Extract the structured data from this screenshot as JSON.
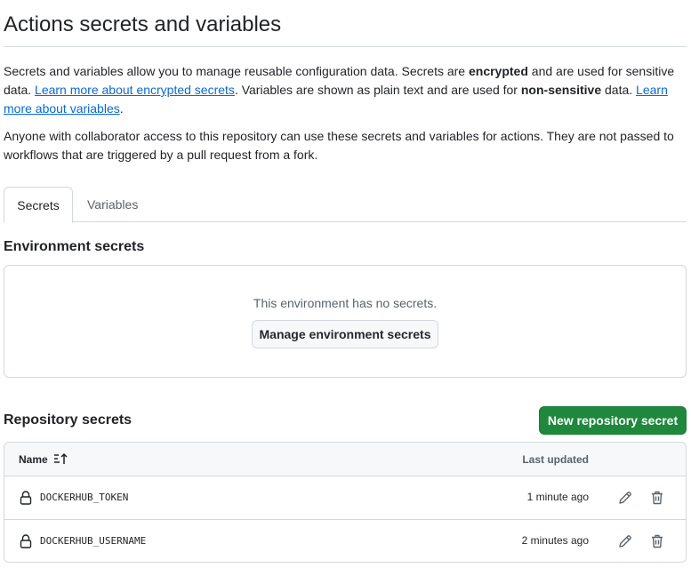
{
  "page": {
    "title": "Actions secrets and variables"
  },
  "intro": {
    "t1": "Secrets and variables allow you to manage reusable configuration data. Secrets are ",
    "b1": "encrypted",
    "t2": " and are used for sensitive data. ",
    "link1": "Learn more about encrypted secrets",
    "t3": ". Variables are shown as plain text and are used for ",
    "b2": "non-sensitive",
    "t4": " data. ",
    "link2": "Learn more about variables",
    "t5": "."
  },
  "note": "Anyone with collaborator access to this repository can use these secrets and variables for actions. They are not passed to workflows that are triggered by a pull request from a fork.",
  "tabs": [
    {
      "label": "Secrets",
      "active": true
    },
    {
      "label": "Variables",
      "active": false
    }
  ],
  "environment": {
    "heading": "Environment secrets",
    "empty_text": "This environment has no secrets.",
    "manage_button": "Manage environment secrets"
  },
  "repository": {
    "heading": "Repository secrets",
    "new_button": "New repository secret",
    "columns": {
      "name": "Name",
      "last_updated": "Last updated"
    },
    "rows": [
      {
        "name": "DOCKERHUB_TOKEN",
        "updated": "1 minute ago"
      },
      {
        "name": "DOCKERHUB_USERNAME",
        "updated": "2 minutes ago"
      }
    ]
  },
  "colors": {
    "link": "#0969da",
    "primary_button": "#1f883d",
    "border": "#d1d9e0",
    "muted": "#59636e"
  },
  "icons": {
    "sort": "sort-ascending-icon",
    "lock": "lock-icon",
    "edit": "pencil-icon",
    "delete": "trash-icon"
  }
}
